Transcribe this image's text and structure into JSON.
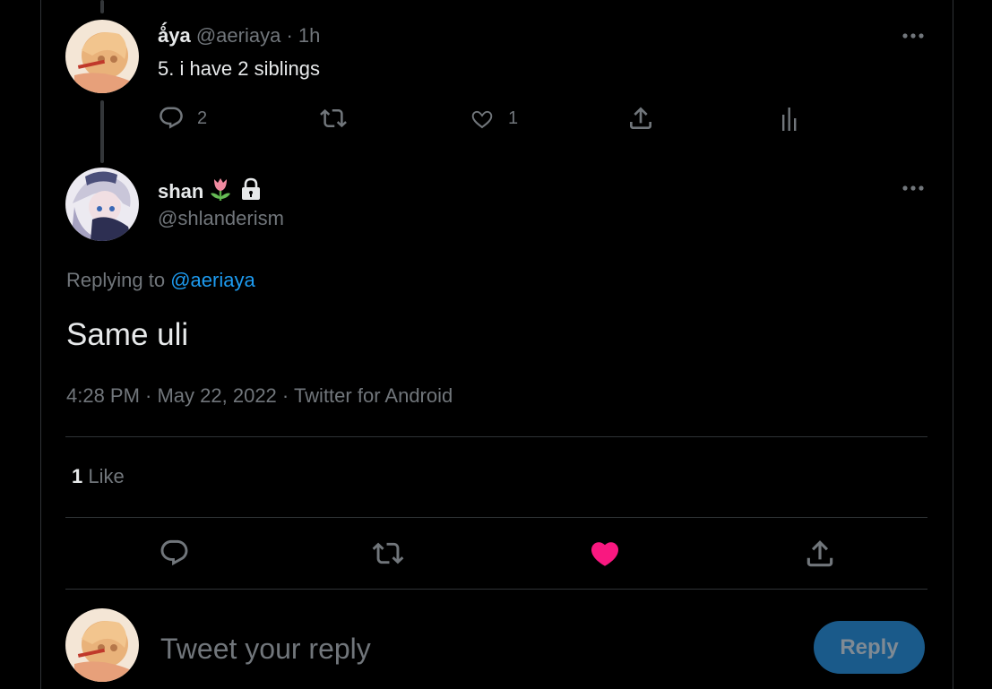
{
  "parent_tweet": {
    "name": "ǻya",
    "handle": "@aeriaya",
    "dot": "·",
    "time": "1h",
    "text": "5. i have 2 siblings",
    "reply_count": "2",
    "like_count": "1"
  },
  "main_tweet": {
    "name": "shan",
    "handle": "@shlanderism",
    "replying_prefix": "Replying to",
    "replying_to": "@aeriaya",
    "text": "Same uli",
    "timestamp": "4:28 PM · May 22, 2022 · Twitter for Android",
    "likes_count": "1",
    "likes_label": "Like",
    "liked": true
  },
  "composer": {
    "placeholder": "Tweet your reply",
    "reply_button": "Reply"
  },
  "icons": {
    "reply": "reply-icon",
    "retweet": "retweet-icon",
    "like": "heart-icon",
    "share": "share-icon",
    "analytics": "analytics-icon",
    "more": "more-icon",
    "tulip": "tulip-emoji-icon",
    "lock": "lock-icon"
  },
  "colors": {
    "accent": "#1d9bf0",
    "like_active": "#f91880",
    "muted": "#71767b",
    "reply_button_bg": "#1a5a8a"
  }
}
